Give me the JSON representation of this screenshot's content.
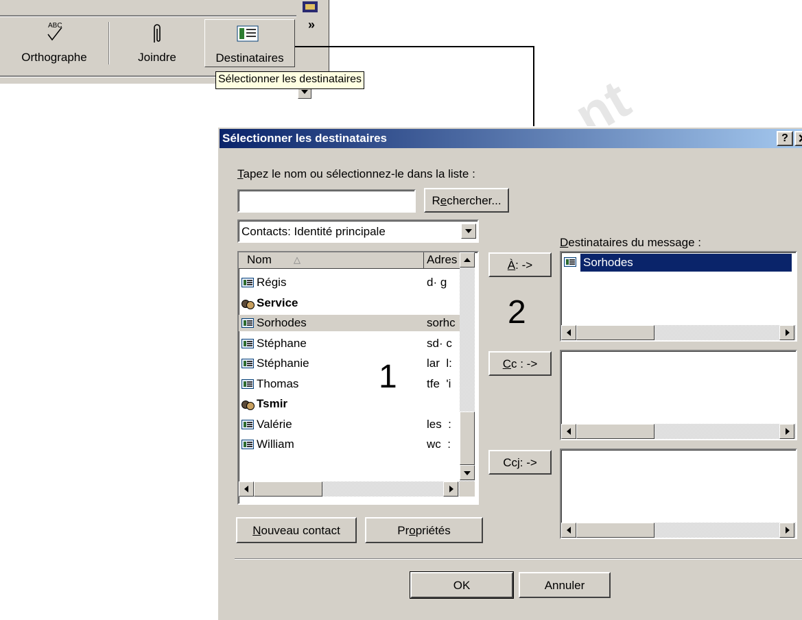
{
  "toolbar": {
    "spell_icon_text": "ABC",
    "spell_label": "Orthographe",
    "attach_label": "Joindre",
    "recipients_label": "Destinataires",
    "more_label": "»",
    "tooltip": "Sélectionner les destinataires"
  },
  "dialog": {
    "title": "Sélectionner les destinataires",
    "help_button": "?",
    "close_button": "×",
    "search_prompt_key": "T",
    "search_prompt_rest": "apez le nom ou sélectionnez-le dans la liste :",
    "search_value": "",
    "find_button_pre": "R",
    "find_button_key": "e",
    "find_button_post": "chercher...",
    "contacts_source": "Contacts: Identité principale",
    "list_headers": {
      "name": "Nom",
      "address": "Adres"
    },
    "contacts": [
      {
        "name": "Régis",
        "address": "d· g",
        "type": "contact",
        "bold": false,
        "selected": false
      },
      {
        "name": "Service",
        "address": "",
        "type": "group",
        "bold": true,
        "selected": false
      },
      {
        "name": "Sorhodes",
        "address": "sorhc",
        "type": "contact",
        "bold": false,
        "selected": true
      },
      {
        "name": "Stéphane",
        "address": "sd· c",
        "type": "contact",
        "bold": false,
        "selected": false
      },
      {
        "name": "Stéphanie",
        "address": "lar  l:",
        "type": "contact",
        "bold": false,
        "selected": false
      },
      {
        "name": "Thomas",
        "address": "tfe  'i",
        "type": "contact",
        "bold": false,
        "selected": false
      },
      {
        "name": "Tsmir",
        "address": "",
        "type": "group",
        "bold": true,
        "selected": false
      },
      {
        "name": "Valérie",
        "address": "les  :",
        "type": "contact",
        "bold": false,
        "selected": false
      },
      {
        "name": "William",
        "address": "wc  :",
        "type": "contact",
        "bold": false,
        "selected": false
      }
    ],
    "to_button_key": "À",
    "to_button_rest": " : ->",
    "cc_button_key": "C",
    "cc_button_rest": "c : ->",
    "bcc_button_pre": "Cc",
    "bcc_button_key": "j",
    "bcc_button_rest": " : ->",
    "recipients_label_key": "D",
    "recipients_label_rest": "estinataires du message :",
    "to_recipients": [
      "Sorhodes"
    ],
    "new_contact_key": "N",
    "new_contact_rest": "ouveau contact",
    "properties_pre": "Pr",
    "properties_key": "o",
    "properties_post": "priétés",
    "ok_label": "OK",
    "cancel_label": "Annuler"
  },
  "annotations": {
    "label_1": "1",
    "label_2": "2"
  },
  "colors": {
    "title_bar_start": "#0a246a",
    "title_bar_end": "#a6caf0",
    "selection": "#0a246a",
    "face": "#d4d0c8",
    "selected_row": "#d4d0c8"
  }
}
